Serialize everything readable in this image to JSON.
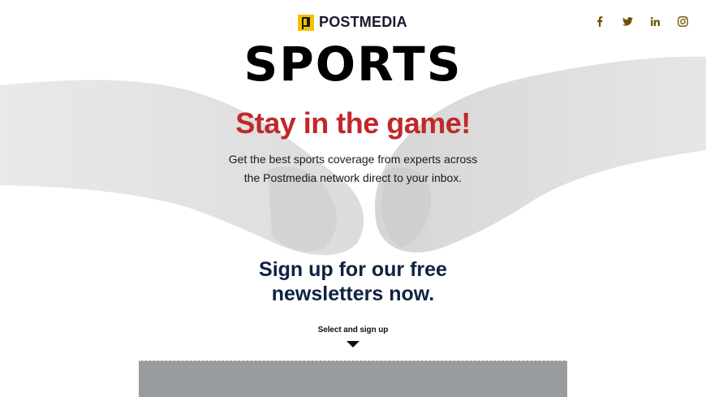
{
  "brand": {
    "name": "POSTMEDIA",
    "logo_color": "#f2c200"
  },
  "socials": [
    {
      "icon": "facebook-icon"
    },
    {
      "icon": "twitter-icon"
    },
    {
      "icon": "linkedin-icon"
    },
    {
      "icon": "instagram-icon"
    }
  ],
  "hero": {
    "title": "SPORTS",
    "tagline": "Stay in the game!",
    "subtext_line1": "Get the best sports coverage from experts across",
    "subtext_line2": "the Postmedia network direct to your inbox."
  },
  "signup": {
    "heading_line1": "Sign up for our free",
    "heading_line2": "newsletters now.",
    "select_label": "Select and sign up"
  },
  "colors": {
    "accent_red": "#c0282a",
    "navy": "#0f2240",
    "icon_gold": "#6b5200",
    "panel_gray": "#989c9f"
  }
}
